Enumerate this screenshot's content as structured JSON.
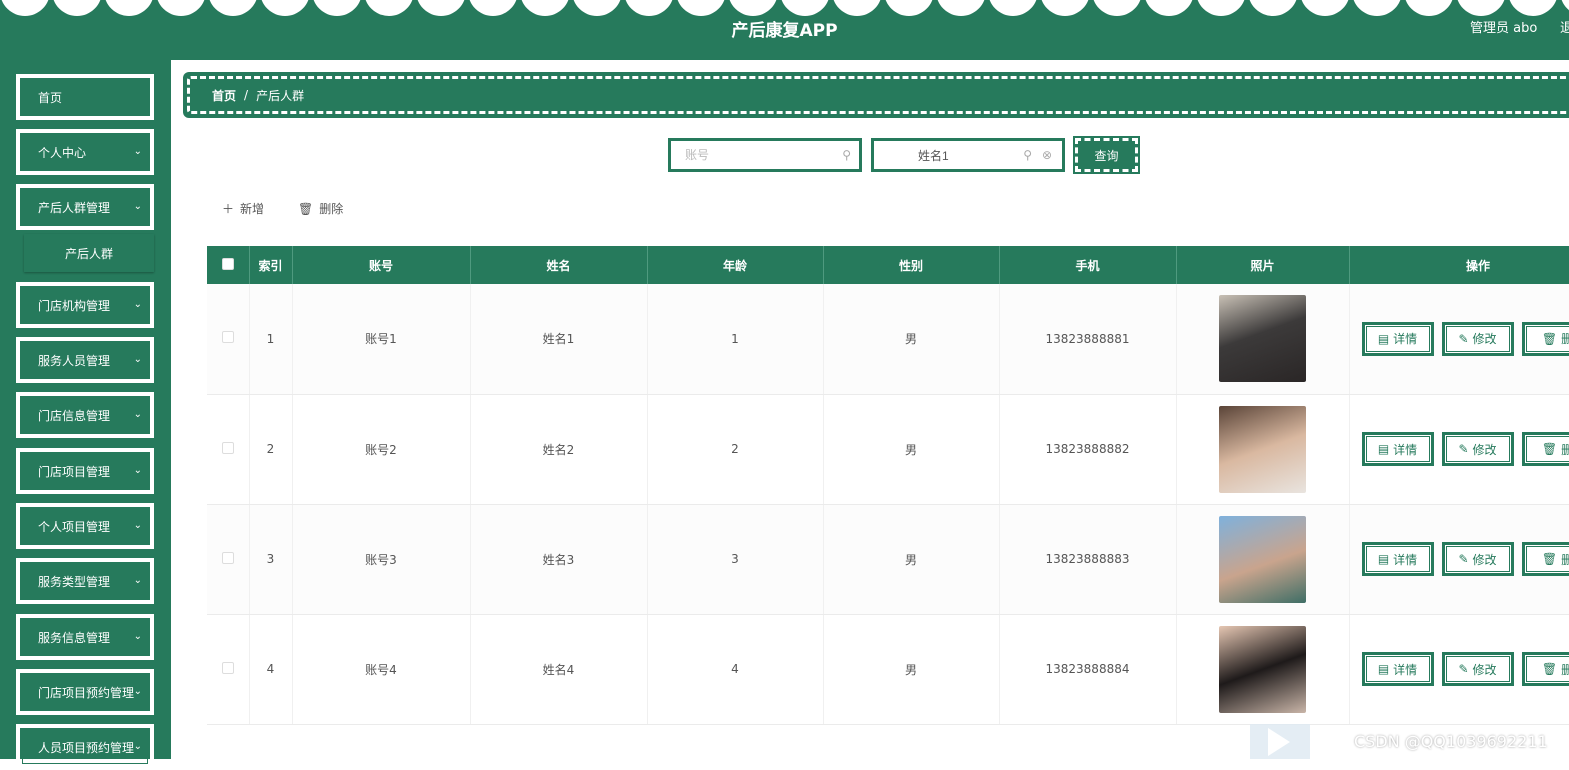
{
  "header": {
    "title": "产后康复APP",
    "admin_label": "管理员 abo",
    "exit_label": "退"
  },
  "sidebar": {
    "items": [
      {
        "label": "首页",
        "has_chevron": false
      },
      {
        "label": "个人中心",
        "has_chevron": true
      },
      {
        "label": "产后人群管理",
        "has_chevron": true
      },
      {
        "label": "门店机构管理",
        "has_chevron": true
      },
      {
        "label": "服务人员管理",
        "has_chevron": true
      },
      {
        "label": "门店信息管理",
        "has_chevron": true
      },
      {
        "label": "门店项目管理",
        "has_chevron": true
      },
      {
        "label": "个人项目管理",
        "has_chevron": true
      },
      {
        "label": "服务类型管理",
        "has_chevron": true
      },
      {
        "label": "服务信息管理",
        "has_chevron": true
      },
      {
        "label": "门店项目预约管理",
        "has_chevron": true
      },
      {
        "label": "人员项目预约管理",
        "has_chevron": true
      }
    ],
    "sub_item": "产后人群",
    "chevron": "⌄"
  },
  "breadcrumb": {
    "home": "首页",
    "sep": "/",
    "current": "产后人群"
  },
  "search": {
    "account_placeholder": "账号",
    "account_value": "",
    "name_placeholder": "姓名",
    "name_value": "姓名1",
    "query_label": "查询"
  },
  "toolbar": {
    "add_label": "新增",
    "delete_label": "删除"
  },
  "table": {
    "headers": [
      "索引",
      "账号",
      "姓名",
      "年龄",
      "性别",
      "手机",
      "照片",
      "操作"
    ],
    "rows": [
      {
        "index": "1",
        "account": "账号1",
        "name": "姓名1",
        "age": "1",
        "gender": "男",
        "phone": "13823888881"
      },
      {
        "index": "2",
        "account": "账号2",
        "name": "姓名2",
        "age": "2",
        "gender": "男",
        "phone": "13823888882"
      },
      {
        "index": "3",
        "account": "账号3",
        "name": "姓名3",
        "age": "3",
        "gender": "男",
        "phone": "13823888883"
      },
      {
        "index": "4",
        "account": "账号4",
        "name": "姓名4",
        "age": "4",
        "gender": "男",
        "phone": "13823888884"
      }
    ],
    "actions": {
      "detail": "详情",
      "edit": "修改",
      "delete": "删"
    }
  },
  "watermark": "CSDN @QQ1039692211",
  "colors": {
    "primary": "#267a5c",
    "white": "#ffffff"
  }
}
